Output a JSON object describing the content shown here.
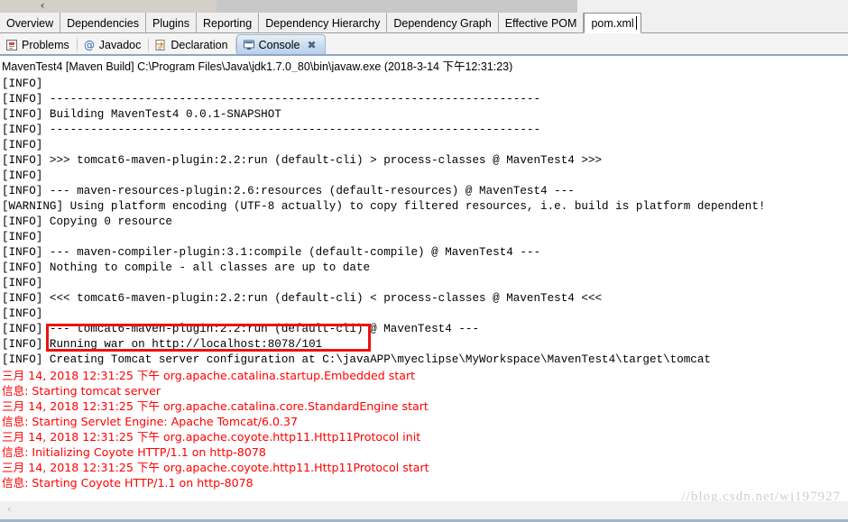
{
  "window": {
    "back_arrow": "‹"
  },
  "editor_tabs": {
    "items": [
      {
        "label": "Overview",
        "active": false
      },
      {
        "label": "Dependencies",
        "active": false
      },
      {
        "label": "Plugins",
        "active": false
      },
      {
        "label": "Reporting",
        "active": false
      },
      {
        "label": "Dependency Hierarchy",
        "active": false
      },
      {
        "label": "Dependency Graph",
        "active": false
      },
      {
        "label": "Effective POM",
        "active": false
      },
      {
        "label": "pom.xml",
        "active": true
      }
    ]
  },
  "view_tabs": {
    "items": [
      {
        "label": "Problems",
        "icon": "problems-icon",
        "active": false,
        "closable": false
      },
      {
        "label": "Javadoc",
        "icon": "javadoc-at-icon",
        "active": false,
        "closable": false
      },
      {
        "label": "Declaration",
        "icon": "declaration-icon",
        "active": false,
        "closable": false
      },
      {
        "label": "Console",
        "icon": "console-icon",
        "active": true,
        "closable": true
      }
    ],
    "close_glyph": "✖"
  },
  "console": {
    "launch_header": "MavenTest4 [Maven Build] C:\\Program Files\\Java\\jdk1.7.0_80\\bin\\javaw.exe (2018-3-14 下午12:31:23)",
    "lines": [
      {
        "text": "[INFO]",
        "color": "black"
      },
      {
        "text": "[INFO] ------------------------------------------------------------------------",
        "color": "black"
      },
      {
        "text": "[INFO] Building MavenTest4 0.0.1-SNAPSHOT",
        "color": "black"
      },
      {
        "text": "[INFO] ------------------------------------------------------------------------",
        "color": "black"
      },
      {
        "text": "[INFO]",
        "color": "black"
      },
      {
        "text": "[INFO] >>> tomcat6-maven-plugin:2.2:run (default-cli) > process-classes @ MavenTest4 >>>",
        "color": "black"
      },
      {
        "text": "[INFO]",
        "color": "black"
      },
      {
        "text": "[INFO] --- maven-resources-plugin:2.6:resources (default-resources) @ MavenTest4 ---",
        "color": "black"
      },
      {
        "text": "[WARNING] Using platform encoding (UTF-8 actually) to copy filtered resources, i.e. build is platform dependent!",
        "color": "black"
      },
      {
        "text": "[INFO] Copying 0 resource",
        "color": "black"
      },
      {
        "text": "[INFO]",
        "color": "black"
      },
      {
        "text": "[INFO] --- maven-compiler-plugin:3.1:compile (default-compile) @ MavenTest4 ---",
        "color": "black"
      },
      {
        "text": "[INFO] Nothing to compile - all classes are up to date",
        "color": "black"
      },
      {
        "text": "[INFO]",
        "color": "black"
      },
      {
        "text": "[INFO] <<< tomcat6-maven-plugin:2.2:run (default-cli) < process-classes @ MavenTest4 <<<",
        "color": "black"
      },
      {
        "text": "[INFO]",
        "color": "black"
      },
      {
        "text": "[INFO] --- tomcat6-maven-plugin:2.2:run (default-cli) @ MavenTest4 ---",
        "color": "black"
      },
      {
        "text": "[INFO] Running war on http://localhost:8078/101",
        "color": "black"
      },
      {
        "text": "[INFO] Creating Tomcat server configuration at C:\\javaAPP\\myeclipse\\MyWorkspace\\MavenTest4\\target\\tomcat",
        "color": "black"
      },
      {
        "text": "三月 14, 2018 12:31:25 下午 org.apache.catalina.startup.Embedded start",
        "color": "red"
      },
      {
        "text": "信息: Starting tomcat server",
        "color": "red"
      },
      {
        "text": "三月 14, 2018 12:31:25 下午 org.apache.catalina.core.StandardEngine start",
        "color": "red"
      },
      {
        "text": "信息: Starting Servlet Engine: Apache Tomcat/6.0.37",
        "color": "red"
      },
      {
        "text": "三月 14, 2018 12:31:25 下午 org.apache.coyote.http11.Http11Protocol init",
        "color": "red"
      },
      {
        "text": "信息: Initializing Coyote HTTP/1.1 on http-8078",
        "color": "red"
      },
      {
        "text": "三月 14, 2018 12:31:25 下午 org.apache.coyote.http11.Http11Protocol start",
        "color": "red"
      },
      {
        "text": "信息: Starting Coyote HTTP/1.1 on http-8078",
        "color": "red"
      }
    ]
  },
  "annotation": {
    "highlight_color": "#ee1111",
    "highlighted_text": "Running war on http://localhost:8078/101"
  },
  "bottom": {
    "scroll_left_glyph": "‹",
    "watermark": "//blog.csdn.net/wj197927"
  }
}
